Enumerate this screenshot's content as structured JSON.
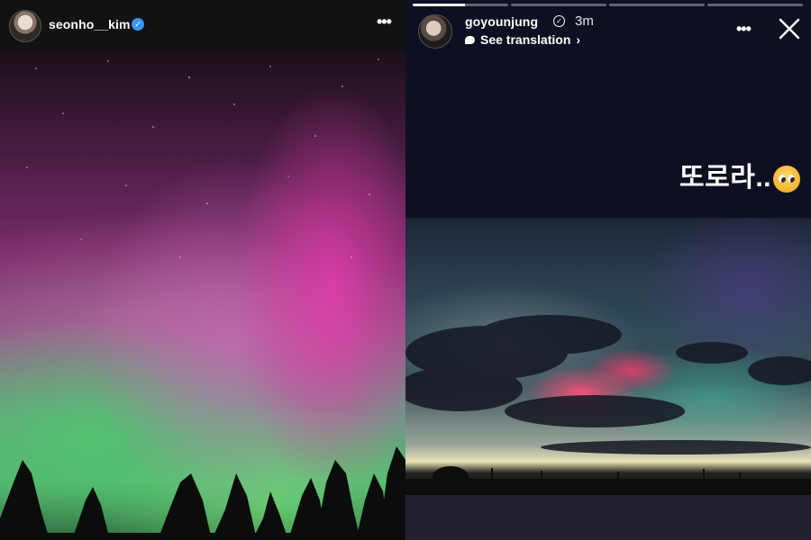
{
  "left_story": {
    "username": "seonho__kim",
    "verified_icon": "verified-badge-icon",
    "more_icon": "more-horizontal-icon",
    "more_label": "•••"
  },
  "right_story": {
    "username": "goyounjung",
    "time": "3m",
    "see_translation": "See translation",
    "translation_chevron": "›",
    "more_label": "•••",
    "story_text": "또로라..",
    "progress": [
      1,
      0,
      0,
      0
    ]
  },
  "colors": {
    "verified_blue": "#3797f0",
    "background_dark": "#0f0f22"
  }
}
